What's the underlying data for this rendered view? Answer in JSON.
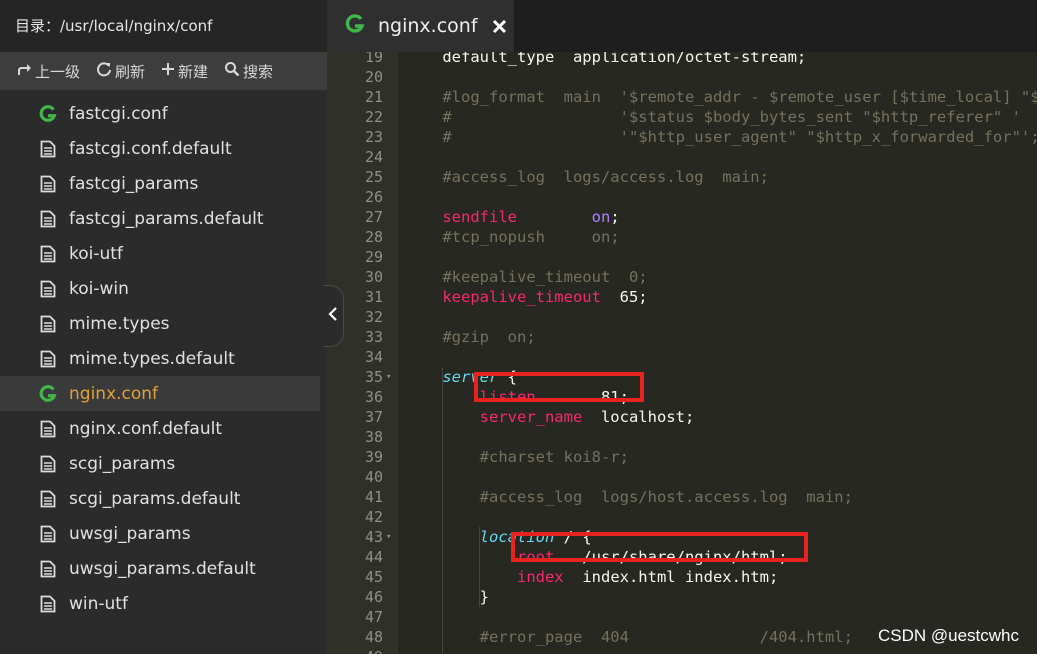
{
  "sidebar": {
    "header_title": "目录：/usr/local/nginx/conf",
    "toolbar": {
      "up_label": "上一级",
      "refresh_label": "刷新",
      "new_label": "新建",
      "search_label": "搜索"
    },
    "files": [
      {
        "name": "fastcgi.conf",
        "icon": "g-logo-icon"
      },
      {
        "name": "fastcgi.conf.default",
        "icon": "document-icon"
      },
      {
        "name": "fastcgi_params",
        "icon": "document-icon"
      },
      {
        "name": "fastcgi_params.default",
        "icon": "document-icon"
      },
      {
        "name": "koi-utf",
        "icon": "document-icon"
      },
      {
        "name": "koi-win",
        "icon": "document-icon"
      },
      {
        "name": "mime.types",
        "icon": "document-icon"
      },
      {
        "name": "mime.types.default",
        "icon": "document-icon"
      },
      {
        "name": "nginx.conf",
        "icon": "g-logo-icon",
        "active": true
      },
      {
        "name": "nginx.conf.default",
        "icon": "document-icon"
      },
      {
        "name": "scgi_params",
        "icon": "document-icon"
      },
      {
        "name": "scgi_params.default",
        "icon": "document-icon"
      },
      {
        "name": "uwsgi_params",
        "icon": "document-icon"
      },
      {
        "name": "uwsgi_params.default",
        "icon": "document-icon"
      },
      {
        "name": "win-utf",
        "icon": "document-icon"
      }
    ]
  },
  "tab": {
    "title": "nginx.conf"
  },
  "colors": {
    "accent_green": "#3fb54a",
    "active_file": "#e0a33a",
    "highlight_box": "#e8221e"
  },
  "editor": {
    "lines": [
      {
        "n": "19",
        "segs": [
          {
            "t": "    default_type  application/octet-stream;",
            "c": ""
          }
        ]
      },
      {
        "n": "20",
        "segs": []
      },
      {
        "n": "21",
        "segs": [
          {
            "t": "    #log_format  main  '$remote_addr - $remote_user [$time_local] \"$request\" '",
            "c": "c-comment"
          }
        ]
      },
      {
        "n": "22",
        "segs": [
          {
            "t": "    #                  '$status $body_bytes_sent \"$http_referer\" '",
            "c": "c-comment"
          }
        ]
      },
      {
        "n": "23",
        "segs": [
          {
            "t": "    #                  '\"$http_user_agent\" \"$http_x_forwarded_for\"';",
            "c": "c-comment"
          }
        ]
      },
      {
        "n": "24",
        "segs": []
      },
      {
        "n": "25",
        "segs": [
          {
            "t": "    #access_log  logs/access.log  main;",
            "c": "c-comment"
          }
        ]
      },
      {
        "n": "26",
        "segs": []
      },
      {
        "n": "27",
        "segs": [
          {
            "t": "    ",
            "c": ""
          },
          {
            "t": "sendfile",
            "c": "c-kw"
          },
          {
            "t": "        ",
            "c": ""
          },
          {
            "t": "on",
            "c": "c-purple"
          },
          {
            "t": ";",
            "c": ""
          }
        ]
      },
      {
        "n": "28",
        "segs": [
          {
            "t": "    #tcp_nopush     on;",
            "c": "c-comment"
          }
        ]
      },
      {
        "n": "29",
        "segs": []
      },
      {
        "n": "30",
        "segs": [
          {
            "t": "    #keepalive_timeout  0;",
            "c": "c-comment"
          }
        ]
      },
      {
        "n": "31",
        "segs": [
          {
            "t": "    ",
            "c": ""
          },
          {
            "t": "keepalive_timeout",
            "c": "c-kw"
          },
          {
            "t": "  65;",
            "c": ""
          }
        ]
      },
      {
        "n": "32",
        "segs": []
      },
      {
        "n": "33",
        "segs": [
          {
            "t": "    #gzip  on;",
            "c": "c-comment"
          }
        ]
      },
      {
        "n": "34",
        "segs": []
      },
      {
        "n": "35",
        "fold": true,
        "segs": [
          {
            "t": "    ",
            "c": ""
          },
          {
            "t": "server",
            "c": "c-italic"
          },
          {
            "t": " {",
            "c": ""
          }
        ]
      },
      {
        "n": "36",
        "segs": [
          {
            "t": "        ",
            "c": ""
          },
          {
            "t": "listen",
            "c": "c-kw"
          },
          {
            "t": "       81;",
            "c": ""
          }
        ]
      },
      {
        "n": "37",
        "segs": [
          {
            "t": "        ",
            "c": ""
          },
          {
            "t": "server_name",
            "c": "c-kw"
          },
          {
            "t": "  localhost;",
            "c": ""
          }
        ]
      },
      {
        "n": "38",
        "segs": []
      },
      {
        "n": "39",
        "segs": [
          {
            "t": "        #charset koi8-r;",
            "c": "c-comment"
          }
        ]
      },
      {
        "n": "40",
        "segs": []
      },
      {
        "n": "41",
        "segs": [
          {
            "t": "        #access_log  logs/host.access.log  main;",
            "c": "c-comment"
          }
        ]
      },
      {
        "n": "42",
        "segs": []
      },
      {
        "n": "43",
        "fold": true,
        "segs": [
          {
            "t": "        ",
            "c": ""
          },
          {
            "t": "location",
            "c": "c-italic"
          },
          {
            "t": " / {",
            "c": ""
          }
        ]
      },
      {
        "n": "44",
        "segs": [
          {
            "t": "            ",
            "c": ""
          },
          {
            "t": "root",
            "c": "c-kw"
          },
          {
            "t": "   /usr/share/nginx/html;",
            "c": ""
          }
        ]
      },
      {
        "n": "45",
        "segs": [
          {
            "t": "            ",
            "c": ""
          },
          {
            "t": "index",
            "c": "c-kw"
          },
          {
            "t": "  index.html index.htm;",
            "c": ""
          }
        ]
      },
      {
        "n": "46",
        "segs": [
          {
            "t": "        }",
            "c": ""
          }
        ]
      },
      {
        "n": "47",
        "segs": []
      },
      {
        "n": "48",
        "segs": [
          {
            "t": "        #error_page  404              /404.html;",
            "c": "c-comment"
          }
        ]
      },
      {
        "n": "49",
        "segs": []
      }
    ]
  },
  "watermark": "CSDN @uestcwhc"
}
